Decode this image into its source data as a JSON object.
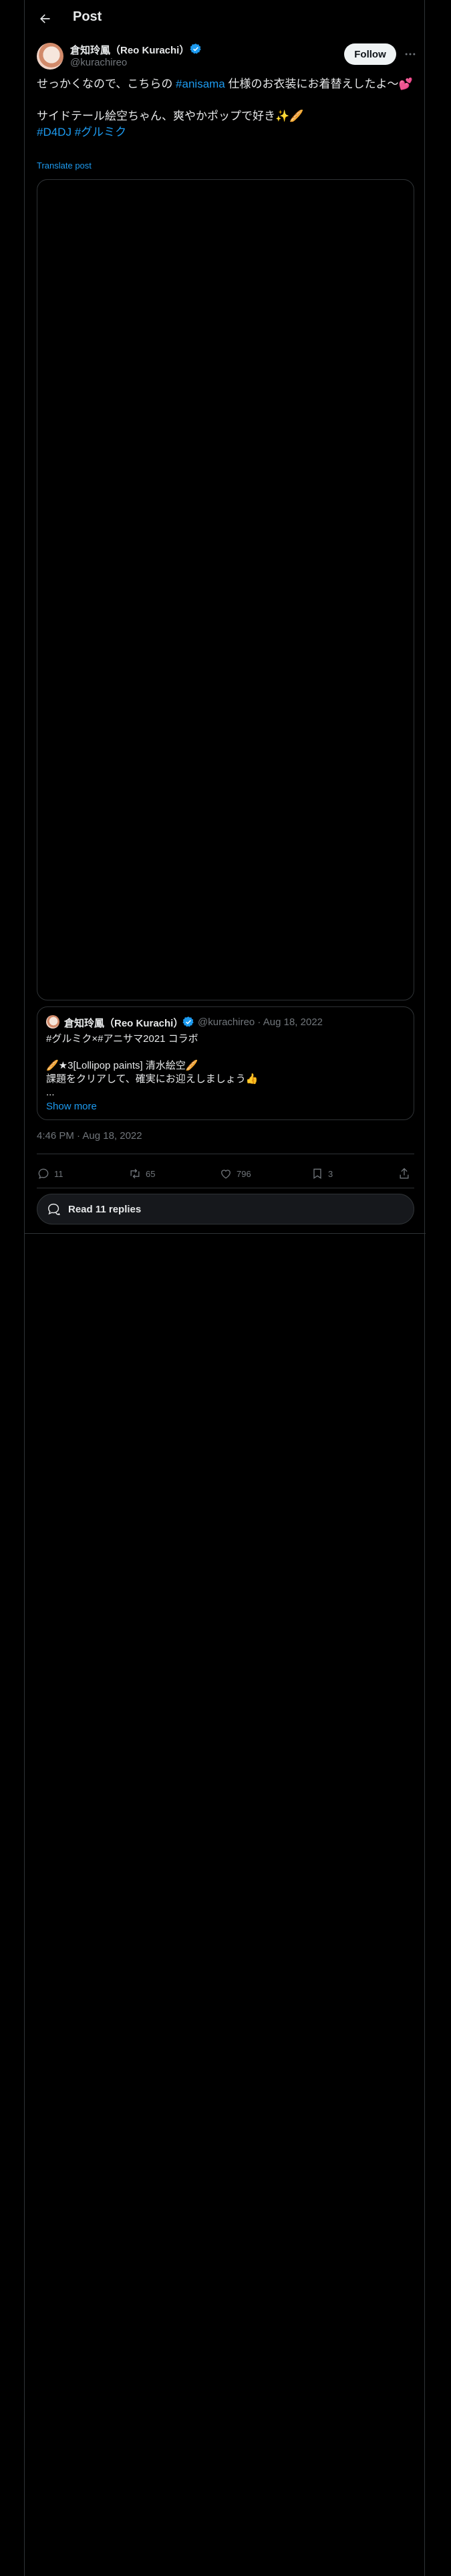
{
  "header": {
    "title": "Post",
    "back_icon": "arrow-left-icon"
  },
  "author": {
    "name": "倉知玲鳳（Reo Kurachi）",
    "handle": "@kurachireo",
    "verified": true,
    "follow_label": "Follow"
  },
  "tweet": {
    "line1_before": "せっかくなので、こちらの ",
    "line1_hashtag": "#anisama",
    "line1_after": " 仕様のお衣装にお着替えしたよ〜💕",
    "line2": "サイドテール絵空ちゃん、爽やかポップで好き✨🥖",
    "hashtag_d4dj": "#D4DJ",
    "hashtag_grumiku": "#グルミク",
    "translate_label": "Translate post"
  },
  "quote": {
    "name": "倉知玲鳳（Reo Kurachi）",
    "handle_date": "@kurachireo · Aug 18, 2022",
    "line1": "#グルミク×#アニサマ2021 コラボ",
    "line2": "🥖★3[Lollipop paints] 清水絵空🥖",
    "line3": "課題をクリアして、確実にお迎えしましょう👍",
    "ellipsis": "...",
    "show_more": "Show more"
  },
  "timestamp": "4:46 PM · Aug 18, 2022",
  "actions": {
    "replies": "11",
    "reposts": "65",
    "likes": "796",
    "bookmarks": "3"
  },
  "read_replies_label": "Read 11 replies",
  "colors": {
    "accent": "#1d9bf0",
    "background": "#000000",
    "muted": "#71767b",
    "border": "#2f3336"
  }
}
